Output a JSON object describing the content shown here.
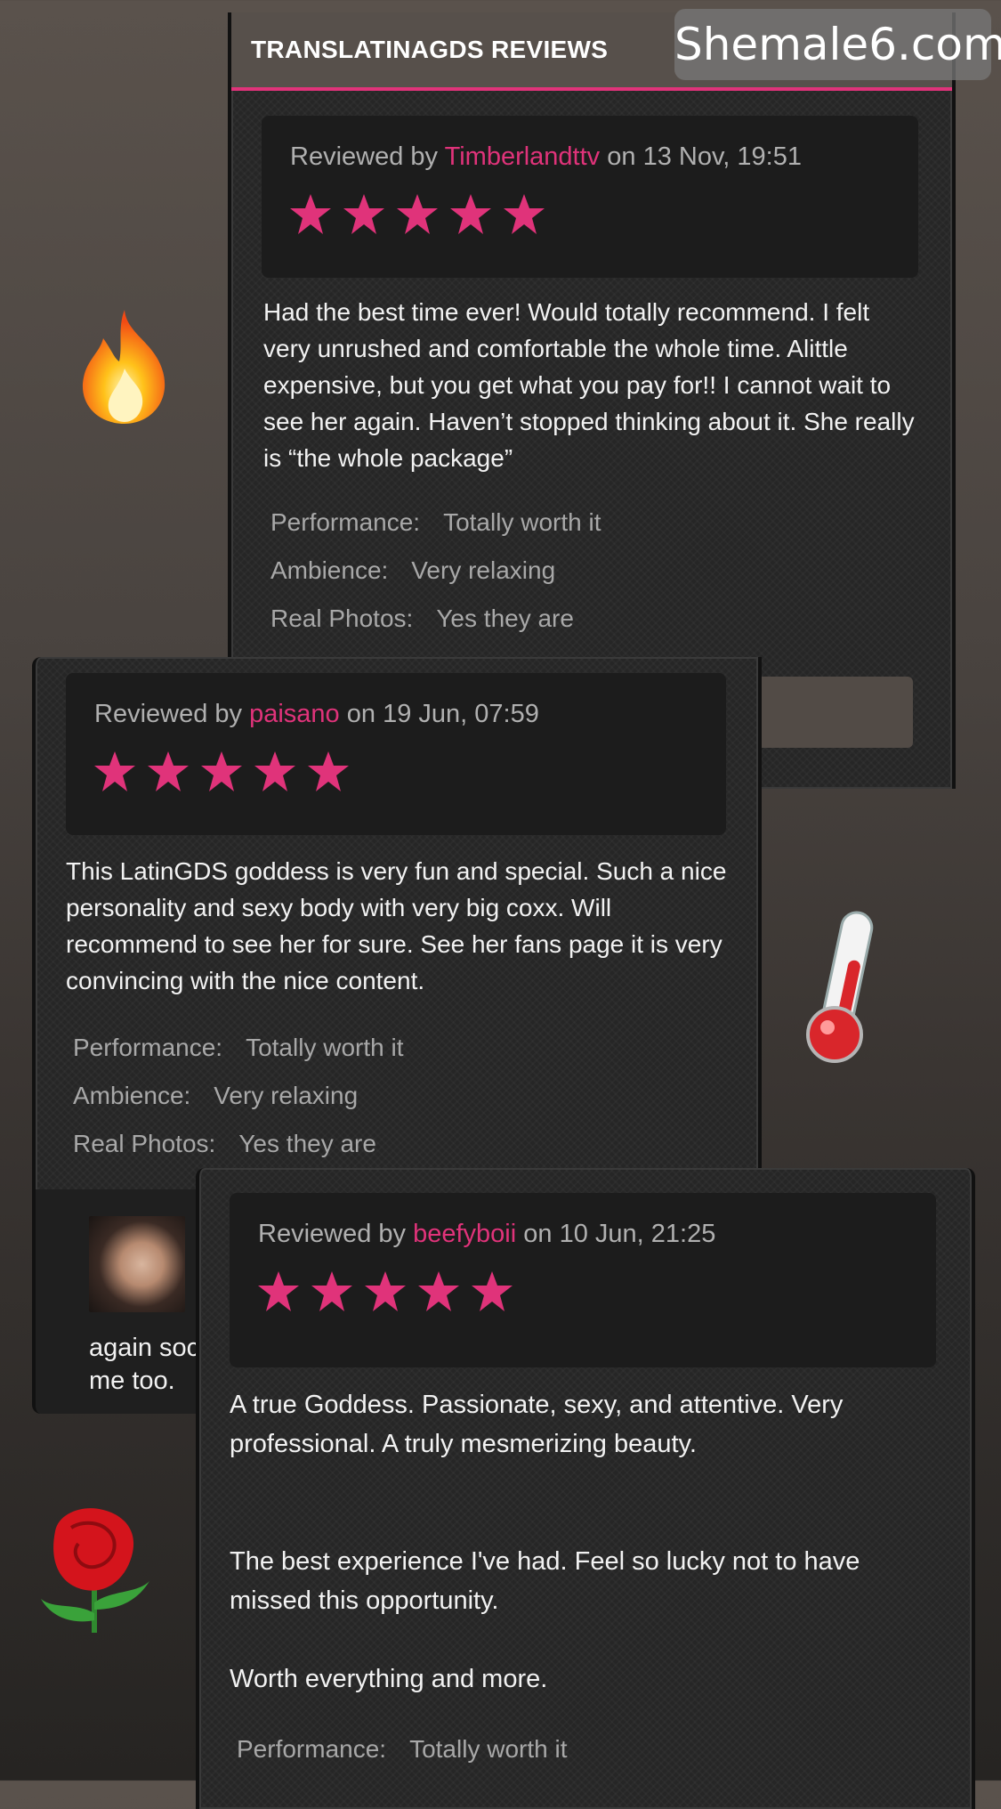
{
  "watermark": "Shemale6.com",
  "section_title": "TRANSLATINAGDS REVIEWS",
  "reviews": [
    {
      "prefix": "Reviewed by",
      "user": "Timberlandttv",
      "date": "on 13 Nov, 19:51",
      "stars": 5,
      "text": "Had the best time ever! Would totally recommend. I felt very unrushed and comfortable the whole time. Alittle expensive, but you get what you pay for!! I cannot wait to see her again. Haven’t stopped thinking about it. She really is “the whole package”",
      "ratings": [
        {
          "label": "Performance:",
          "value": "Totally worth it"
        },
        {
          "label": "Ambience:",
          "value": "Very relaxing"
        },
        {
          "label": "Real Photos:",
          "value": "Yes they are"
        }
      ]
    },
    {
      "prefix": "Reviewed by",
      "user": "paisano",
      "date": "on 19 Jun, 07:59",
      "stars": 5,
      "text": "This LatinGDS goddess is very fun and special. Such a nice personality and sexy body with very big coxx. Will recommend to see her for sure. See her fans page it is very convincing with the nice content.",
      "ratings": [
        {
          "label": "Performance:",
          "value": "Totally worth it"
        },
        {
          "label": "Ambience:",
          "value": "Very relaxing"
        },
        {
          "label": "Real Photos:",
          "value": "Yes they are"
        }
      ],
      "reply_partial": "again soc\nme too."
    },
    {
      "prefix": "Reviewed by",
      "user": "beefyboii",
      "date": "on 10 Jun, 21:25",
      "stars": 5,
      "text_p1": "A true Goddess. Passionate, sexy, and attentive. Very professional. A truly mesmerizing beauty.",
      "text_p2": "The best experience I've had. Feel so lucky not to have missed this opportunity.",
      "text_p3": "Worth everything and more.",
      "ratings": [
        {
          "label": "Performance:",
          "value": "Totally worth it"
        }
      ]
    }
  ],
  "colors": {
    "accent": "#e0337a",
    "card": "#262626",
    "header": "#57504b"
  },
  "icons": [
    "fire-icon",
    "thermometer-icon",
    "rose-icon",
    "star-icon"
  ]
}
